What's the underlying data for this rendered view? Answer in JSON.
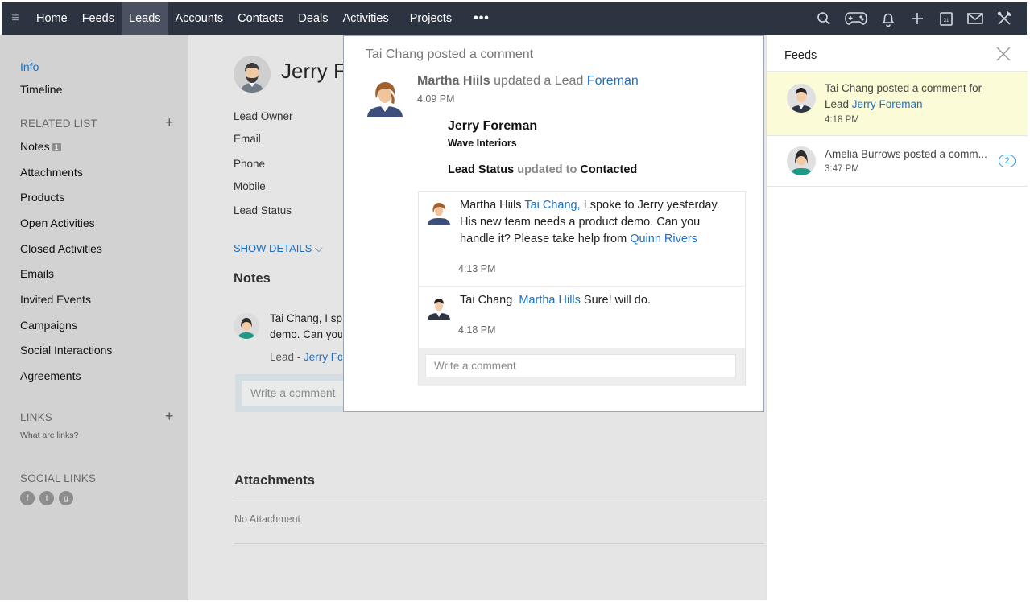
{
  "topnav": {
    "items": [
      "Home",
      "Feeds",
      "Leads",
      "Accounts",
      "Contacts",
      "Deals",
      "Activities",
      "Projects"
    ],
    "active": "Leads",
    "more": "•••",
    "icons": [
      "search-icon",
      "game-controller-icon",
      "bell-icon",
      "plus-icon",
      "calendar-icon",
      "mail-icon",
      "tools-icon"
    ],
    "calendar_day": "31"
  },
  "sidebar": {
    "info": "Info",
    "timeline": "Timeline",
    "related_list_title": "RELATED LIST",
    "related_items": [
      "Notes",
      "Attachments",
      "Products",
      "Open Activities",
      "Closed Activities",
      "Emails",
      "Invited Events",
      "Campaigns",
      "Social Interactions",
      "Agreements"
    ],
    "notes_count": "1",
    "links_title": "LINKS",
    "links_help": "What are links?",
    "social_title": "SOCIAL LINKS",
    "social_icons": [
      "facebook-icon",
      "twitter-icon",
      "google-plus-icon"
    ]
  },
  "main": {
    "lead_name": "Jerry F",
    "fields": [
      "Lead Owner",
      "Email",
      "Phone",
      "Mobile",
      "Lead Status"
    ],
    "show_details": "SHOW DETAILS ⌵",
    "notes_title": "Notes",
    "note_line1": "Tai Chang, I sp",
    "note_line2": "demo. Can you",
    "note_lead_prefix": "Lead - ",
    "note_lead_link": "Jerry Fo",
    "comment_placeholder": "Write a comment",
    "attachments_title": "Attachments",
    "no_attachment": "No Attachment"
  },
  "popup": {
    "header": "Tai Chang posted a comment",
    "actor": "Martha Hiils",
    "action": " updated a Lead ",
    "lead_link": "Foreman",
    "time": "4:09 PM",
    "lead_name": "Jerry Foreman",
    "company": "Wave Interiors",
    "status_key": "Lead Status",
    "status_mid": " updated to ",
    "status_value": "Contacted",
    "comments": [
      {
        "author": "Martha Hiils",
        "mention": "Tai Chang,",
        "text": " I spoke to Jerry yesterday. His new team needs a product demo. Can you handle it? Please take help from ",
        "mention2": "Quinn Rivers",
        "time": "4:13 PM"
      },
      {
        "author": "Tai Chang",
        "mention": "Martha Hills",
        "text": " Sure! will do.",
        "time": "4:18 PM"
      }
    ],
    "comment_placeholder": "Write a comment"
  },
  "feeds": {
    "title": "Feeds",
    "items": [
      {
        "text": "Tai Chang posted a comment for Lead ",
        "link": "Jerry Foreman",
        "time": "4:18 PM"
      },
      {
        "text": "Amelia Burrows posted a comm...",
        "time": "3:47 PM",
        "badge": "2"
      }
    ]
  }
}
